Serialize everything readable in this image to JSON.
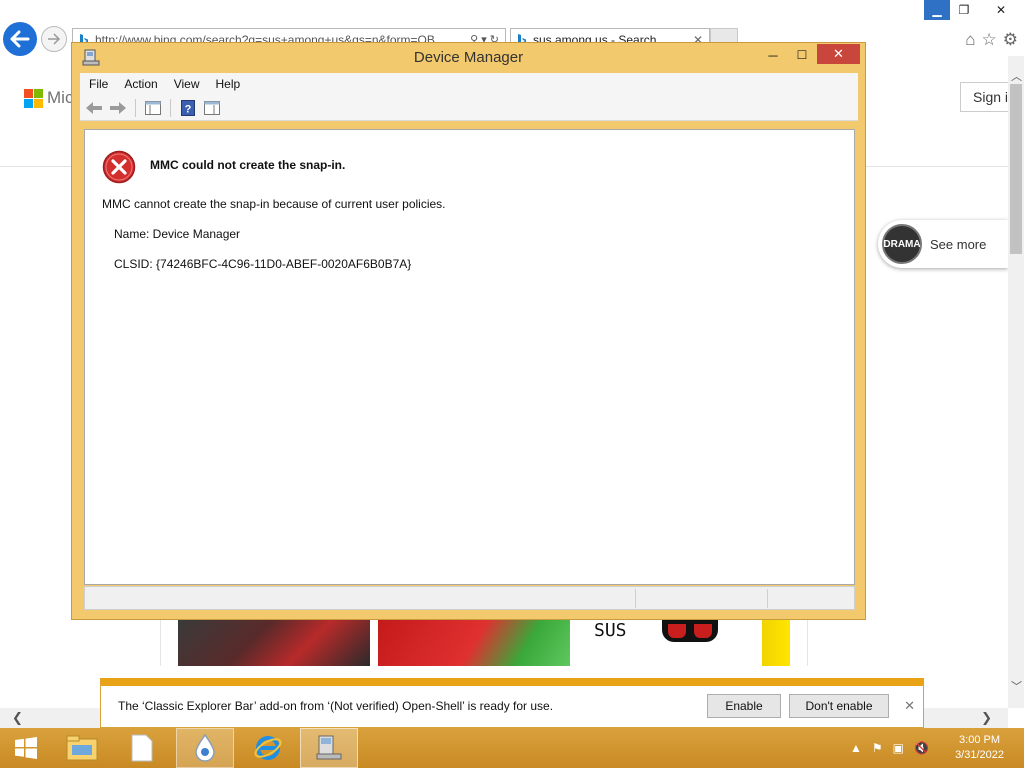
{
  "browser": {
    "address_url": "http://www.bing.com/search?q=sus+among+us&qs=n&form=QB",
    "tab_title": "sus among us - Search",
    "colors": {
      "back_button": "#1e6fd6",
      "minimize_highlight": "#2f71c5"
    },
    "icons": [
      "back-arrow-icon",
      "forward-arrow-icon",
      "bing-icon",
      "search-icon",
      "refresh-icon",
      "home-icon",
      "favorites-star-icon",
      "settings-gear-icon"
    ]
  },
  "webpage": {
    "brand_text": "Mic",
    "sign_in_label": "Sign i",
    "see_more_label": "See more",
    "avatar_text": "DRAMA",
    "thumb_text": "SUS"
  },
  "device_manager": {
    "title": "Device Manager",
    "menus": [
      "File",
      "Action",
      "View",
      "Help"
    ],
    "error": {
      "heading": "MMC could not create the snap-in.",
      "message": "MMC cannot create the snap-in because of current user policies.",
      "name_line": "Name: Device Manager",
      "clsid_line": "CLSID: {74246BFC-4C96-11D0-ABEF-0020AF6B0B7A}"
    },
    "colors": {
      "frame": "#f3c96d",
      "close": "#c9463d",
      "error_icon": "#d32f2f"
    }
  },
  "notification": {
    "message": "The ‘Classic Explorer Bar’ add-on from ‘(Not verified) Open-Shell’ is ready for use.",
    "enable_label": "Enable",
    "dont_enable_label": "Don't enable",
    "accent_color": "#e8a317"
  },
  "taskbar": {
    "time": "3:00 PM",
    "date": "3/31/2022",
    "color": "#d19530"
  }
}
